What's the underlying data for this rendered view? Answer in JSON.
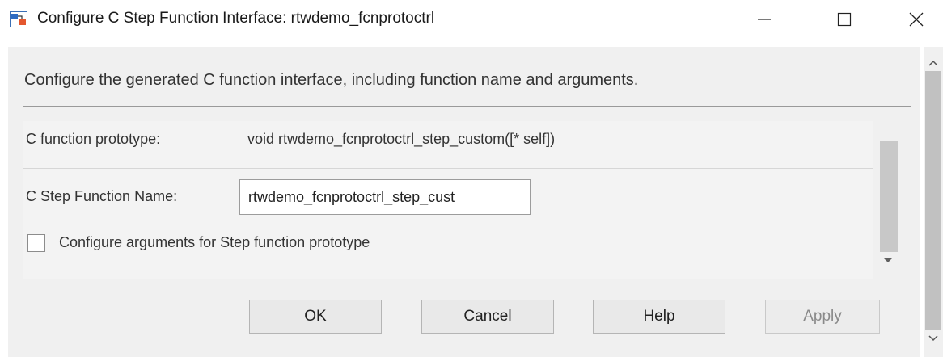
{
  "window": {
    "title": "Configure C Step Function Interface: rtwdemo_fcnprotoctrl",
    "icon": "simulink-model-icon"
  },
  "description": "Configure the generated C function interface, including function name and arguments.",
  "prototype": {
    "label": "C function prototype:",
    "value": "void rtwdemo_fcnprotoctrl_step_custom([* self])"
  },
  "step_name": {
    "label": "C Step Function Name:",
    "value": "rtwdemo_fcnprotoctrl_step_cust"
  },
  "configure_args": {
    "label": "Configure arguments for Step function prototype",
    "checked": false
  },
  "buttons": {
    "ok": "OK",
    "cancel": "Cancel",
    "help": "Help",
    "apply": "Apply"
  },
  "colors": {
    "frame_bg": "#f0f0f0",
    "disabled_text": "#8a8a8a"
  }
}
